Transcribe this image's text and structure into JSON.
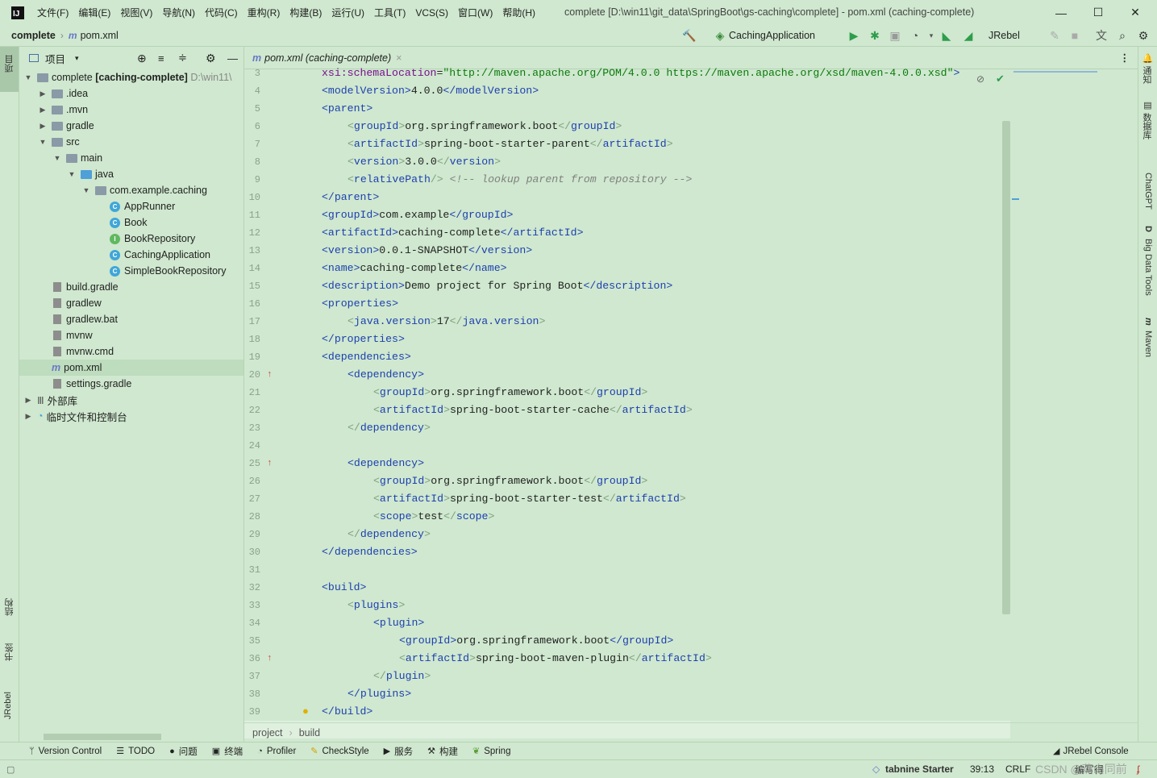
{
  "titlebar": {
    "app_icon": "IJ",
    "menus": [
      "文件(F)",
      "编辑(E)",
      "视图(V)",
      "导航(N)",
      "代码(C)",
      "重构(R)",
      "构建(B)",
      "运行(U)",
      "工具(T)",
      "VCS(S)",
      "窗口(W)",
      "帮助(H)"
    ],
    "window_title": "complete [D:\\win11\\git_data\\SpringBoot\\gs-caching\\complete] - pom.xml (caching-complete)"
  },
  "navbar": {
    "project": "complete",
    "file_icon": "m",
    "file": "pom.xml",
    "run_config": "CachingApplication",
    "jrebel": "JRebel"
  },
  "left_strip": {
    "tabs": [
      "项目",
      "结构",
      "书签",
      "JRebel"
    ]
  },
  "right_strip": {
    "tabs": [
      "通知",
      "数据库",
      "ChatGPT",
      "Big Data Tools",
      "Maven"
    ]
  },
  "project_panel": {
    "header": "项目",
    "root_name": "complete",
    "root_module": "[caching-complete]",
    "root_path": "D:\\win11\\",
    "items": [
      {
        "label": ".idea"
      },
      {
        "label": ".mvn"
      },
      {
        "label": "gradle"
      },
      {
        "label": "src"
      },
      {
        "label": "main"
      },
      {
        "label": "java"
      },
      {
        "label": "com.example.caching"
      },
      {
        "label": "AppRunner"
      },
      {
        "label": "Book"
      },
      {
        "label": "BookRepository"
      },
      {
        "label": "CachingApplication"
      },
      {
        "label": "SimpleBookRepository"
      },
      {
        "label": "build.gradle"
      },
      {
        "label": "gradlew"
      },
      {
        "label": "gradlew.bat"
      },
      {
        "label": "mvnw"
      },
      {
        "label": "mvnw.cmd"
      },
      {
        "label": "pom.xml"
      },
      {
        "label": "settings.gradle"
      },
      {
        "label": "外部库"
      },
      {
        "label": "临时文件和控制台"
      }
    ]
  },
  "editor": {
    "tab_label": "pom.xml (caching-complete)",
    "line_numbers": [
      "3",
      "4",
      "5",
      "6",
      "7",
      "8",
      "9",
      "10",
      "11",
      "12",
      "13",
      "14",
      "15",
      "16",
      "17",
      "18",
      "19",
      "20",
      "21",
      "22",
      "23",
      "24",
      "25",
      "26",
      "27",
      "28",
      "29",
      "30",
      "31",
      "32",
      "33",
      "34",
      "35",
      "36",
      "37",
      "38",
      "39"
    ],
    "code": [
      "xsi:schemaLocation=\"http://maven.apache.org/POM/4.0.0 https://maven.apache.org/xsd/maven-4.0.0.xsd\">",
      "<modelVersion>4.0.0</modelVersion>",
      "<parent>",
      "<groupId>org.springframework.boot</groupId>",
      "<artifactId>spring-boot-starter-parent</artifactId>",
      "<version>3.0.0</version>",
      "<relativePath/> <!-- lookup parent from repository -->",
      "</parent>",
      "<groupId>com.example</groupId>",
      "<artifactId>caching-complete</artifactId>",
      "<version>0.0.1-SNAPSHOT</version>",
      "<name>caching-complete</name>",
      "<description>Demo project for Spring Boot</description>",
      "<properties>",
      "<java.version>17</java.version>",
      "</properties>",
      "<dependencies>",
      "<dependency>",
      "<groupId>org.springframework.boot</groupId>",
      "<artifactId>spring-boot-starter-cache</artifactId>",
      "</dependency>",
      "",
      "<dependency>",
      "<groupId>org.springframework.boot</groupId>",
      "<artifactId>spring-boot-starter-test</artifactId>",
      "<scope>test</scope>",
      "</dependency>",
      "</dependencies>",
      "",
      "<build>",
      "<plugins>",
      "<plugin>",
      "<groupId>org.springframework.boot</groupId>",
      "<artifactId>spring-boot-maven-plugin</artifactId>",
      "</plugin>",
      "</plugins>",
      "</build>"
    ],
    "breadcrumb": [
      "project",
      "build"
    ]
  },
  "bottom_tools": [
    "Version Control",
    "TODO",
    "问题",
    "终端",
    "Profiler",
    "CheckStyle",
    "服务",
    "构建",
    "Spring"
  ],
  "jrebel_console": "JRebel Console",
  "status": {
    "tabnine": "tabnine Starter",
    "position": "39:13",
    "line_sep": "CRLF",
    "watermark": "CSDN @燕山同前",
    "extra": "编写得"
  }
}
